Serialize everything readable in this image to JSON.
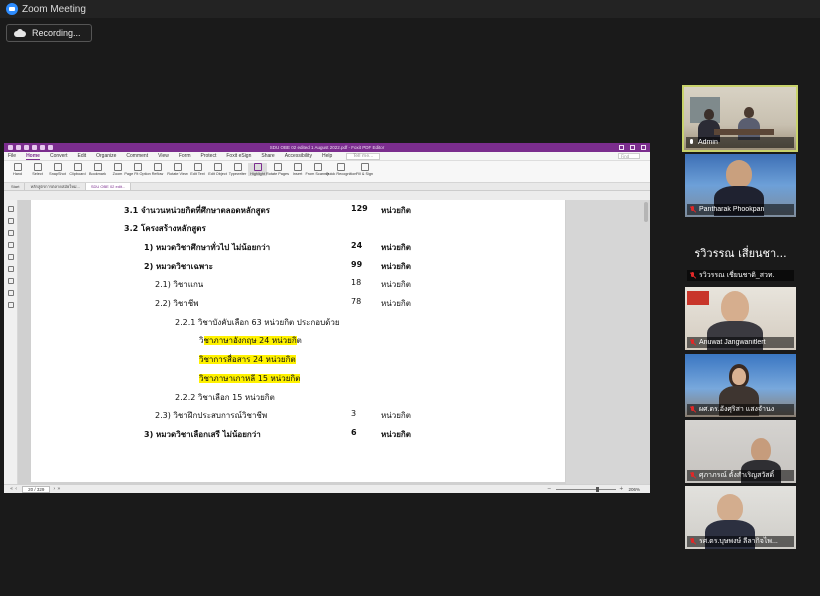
{
  "window": {
    "title": "Zoom Meeting"
  },
  "recording": {
    "label": "Recording..."
  },
  "foxit": {
    "title": "SDU OBE 02 edited 1 August 2022.pdf - Foxit PDF Editor",
    "menu": [
      "File",
      "Home",
      "Convert",
      "Edit",
      "Organize",
      "Comment",
      "View",
      "Form",
      "Protect",
      "Foxit eSign",
      "Share",
      "Accessibility",
      "Help"
    ],
    "active_menu": "Home",
    "tell_me": "Tell me...",
    "find": "Find",
    "ribbon": [
      "Hand",
      "Select",
      "SnapShot",
      "Clipboard",
      "Bookmark",
      "Zoom",
      "Page Fit Option",
      "Reflow",
      "Rotate View",
      "Edit Text",
      "Edit Object",
      "Typewriter",
      "Highlight",
      "Rotate Pages",
      "Insert",
      "From Scanner",
      "Quick Recognition",
      "Fill & Sign"
    ],
    "selected_tool": "Highlight",
    "tabs": [
      "Start",
      "หลักสูตรการตลาดสมัยใหม่...",
      "SDU OBE 02 edit..."
    ],
    "active_tab": "SDU OBE 02 edit...",
    "page_indicator": "20 / 329",
    "zoom_level": "206%",
    "colors": {
      "brand": "#7b2d8e",
      "highlight": "#fff200"
    }
  },
  "document": {
    "l1": {
      "label": "3.1 จำนวนหน่วยกิตที่ศึกษาตลอดหลักสูตร",
      "value": "129",
      "unit": "หน่วยกิต"
    },
    "l2": {
      "label": "3.2 โครงสร้างหลักสูตร"
    },
    "l3": {
      "label": "1) หมวดวิชาศึกษาทั่วไป ไม่น้อยกว่า",
      "value": "24",
      "unit": "หน่วยกิต"
    },
    "l4": {
      "label": "2) หมวดวิชาเฉพาะ",
      "value": "99",
      "unit": "หน่วยกิต"
    },
    "l5": {
      "label": "2.1) วิชาแกน",
      "value": "18",
      "unit": "หน่วยกิต"
    },
    "l6": {
      "label": "2.2) วิชาชีพ",
      "value": "78",
      "unit": "หน่วยกิต"
    },
    "l7": {
      "label": "2.2.1 วิชาบังคับเลือก 63 หน่วยกิต ประกอบด้วย"
    },
    "l8": {
      "prefix": "วิ",
      "highlighted": "ชาภาษาอังกฤษ 24 หน่วยกิ",
      "suffix": "ต"
    },
    "l9": {
      "highlighted": "วิชาการสื่อสาร 24 หน่วยกิต"
    },
    "l10": {
      "highlighted": "วิชาภาษาเกาหลี 15 หน่วยกิต"
    },
    "l11": {
      "label": "2.2.2 วิชาเลือก 15 หน่วยกิต"
    },
    "l12": {
      "label": "2.3) วิชาฝึกประสบการณ์วิชาชีพ",
      "value": "3",
      "unit": "หน่วยกิต"
    },
    "l13": {
      "label": "3) หมวดวิชาเลือกเสรี ไม่น้อยกว่า",
      "value": "6",
      "unit": "หน่วยกิต"
    }
  },
  "participants": [
    {
      "name": "Admin",
      "muted": false,
      "active": true
    },
    {
      "name": "Pantharak Phookpan",
      "muted": true
    },
    {
      "name": "รวิวรรณ เชี่ยนชาติ_สวท.",
      "avatar_text": "รวิวรรณ เสี่ยนชา...",
      "muted": true
    },
    {
      "name": "Anuwat Jangwanitlert",
      "muted": true
    },
    {
      "name": "ผศ.ดร.อังศุริสา แสงจำนง",
      "muted": true
    },
    {
      "name": "ศุภาภรณ์ ตั้งสำเริญสวัสดิ์",
      "muted": true
    },
    {
      "name": "รศ.ดร.บุษพงษ์ ลีลากิจไพ...",
      "muted": true
    }
  ]
}
